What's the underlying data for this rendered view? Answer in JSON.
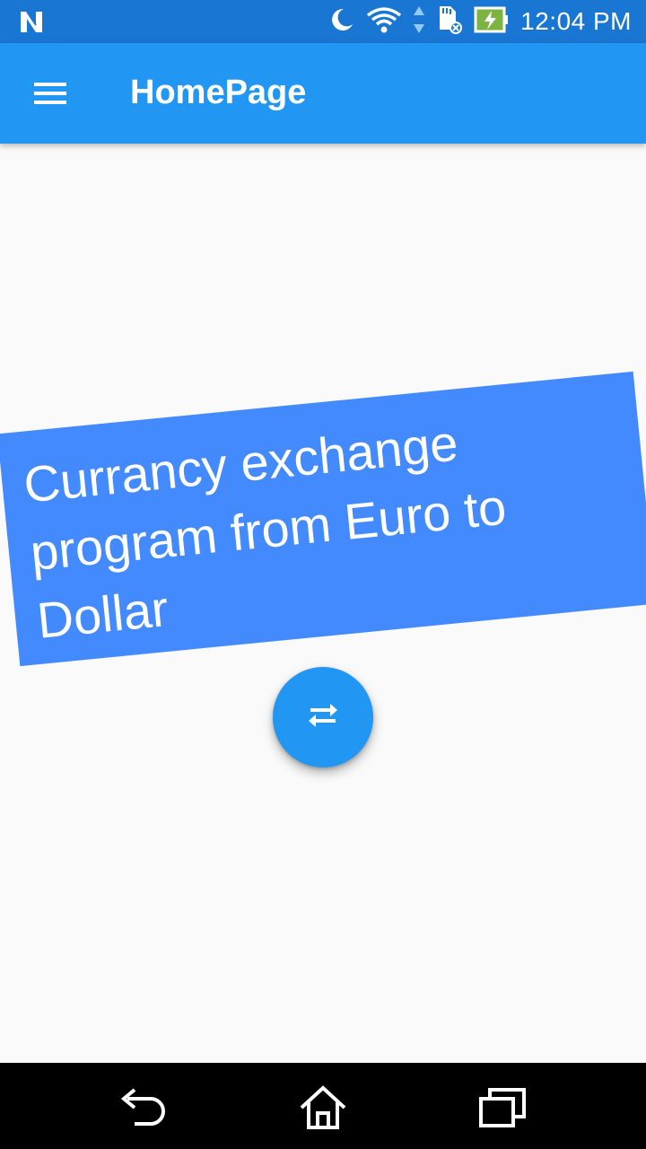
{
  "status_bar": {
    "time": "12:04 PM",
    "icons": [
      "n-logo-icon",
      "moon-icon",
      "wifi-icon",
      "data-arrows-icon",
      "sd-card-icon",
      "battery-charging-icon"
    ]
  },
  "app_bar": {
    "title": "HomePage",
    "menu_icon": "hamburger-menu-icon"
  },
  "main": {
    "banner_text": "Currancy exchange program from Euro to Dollar",
    "banner_color": "#448aff",
    "fab_icon": "swap-horiz-icon"
  },
  "nav_bar": {
    "buttons": [
      "back-icon",
      "home-icon",
      "recents-icon"
    ]
  },
  "colors": {
    "status_bar": "#1976d2",
    "app_bar": "#2196f3",
    "background": "#fafafa",
    "fab": "#2196f3",
    "nav_bar": "#000000"
  }
}
